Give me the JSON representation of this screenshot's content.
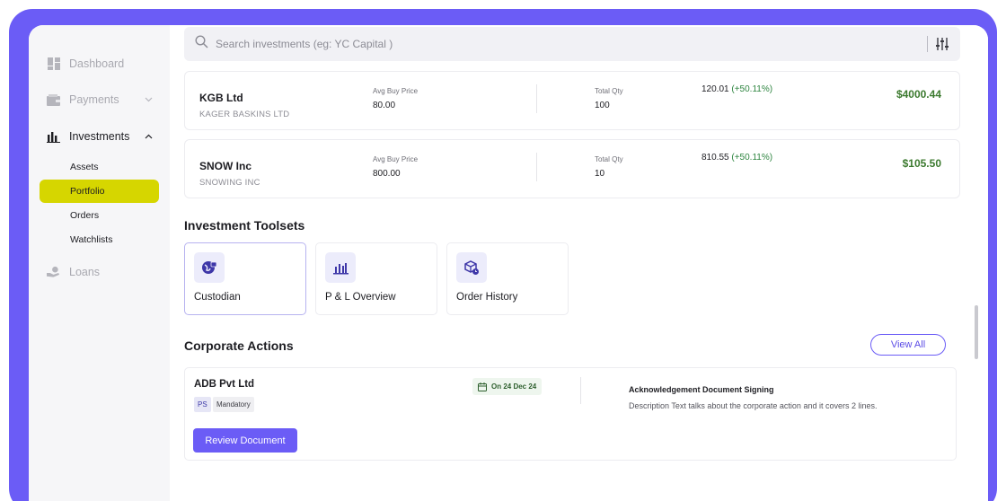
{
  "sidebar": {
    "items": [
      {
        "label": "Dashboard",
        "icon": "dashboard-icon"
      },
      {
        "label": "Payments",
        "icon": "wallet-icon"
      },
      {
        "label": "Investments",
        "icon": "bar-chart-icon"
      },
      {
        "label": "Loans",
        "icon": "hand-coin-icon"
      }
    ],
    "sub_items": [
      "Assets",
      "Portfolio",
      "Orders",
      "Watchlists"
    ],
    "selected": "Portfolio"
  },
  "search": {
    "placeholder": "Search investments (eg: YC Capital )"
  },
  "holdings": [
    {
      "name": "KGB Ltd",
      "full_name": "KAGER BASKINS LTD",
      "avg_label": "Avg Buy Price",
      "avg": "80.00",
      "qty_label": "Total Qty",
      "qty": "100",
      "ltp": "120.01",
      "change": "(+50.11%)",
      "amount": "$4000.44"
    },
    {
      "name": "SNOW Inc",
      "full_name": "SNOWING INC",
      "avg_label": "Avg Buy Price",
      "avg": "800.00",
      "qty_label": "Total Qty",
      "qty": "10",
      "ltp": "810.55",
      "change": "(+50.11%)",
      "amount": "$105.50"
    }
  ],
  "toolsets": {
    "title": "Investment Toolsets",
    "items": [
      {
        "label": "Custodian",
        "icon": "globe-lock-icon"
      },
      {
        "label": "P & L Overview",
        "icon": "bar-chart-icon"
      },
      {
        "label": "Order History",
        "icon": "box-clock-icon"
      }
    ]
  },
  "corporate_actions": {
    "title": "Corporate Actions",
    "view_all": "View All",
    "card": {
      "company": "ADB Pvt Ltd",
      "tag_short": "PS",
      "tag_type": "Mandatory",
      "date": "On 24 Dec 24",
      "action_title": "Acknowledgement Document Signing",
      "description": "Description Text talks about the  corporate action and it covers 2 lines.",
      "button": "Review Document"
    }
  },
  "colors": {
    "accent": "#6b5cf6",
    "selected_nav": "#d6d600",
    "positive": "#3c7a2f"
  }
}
